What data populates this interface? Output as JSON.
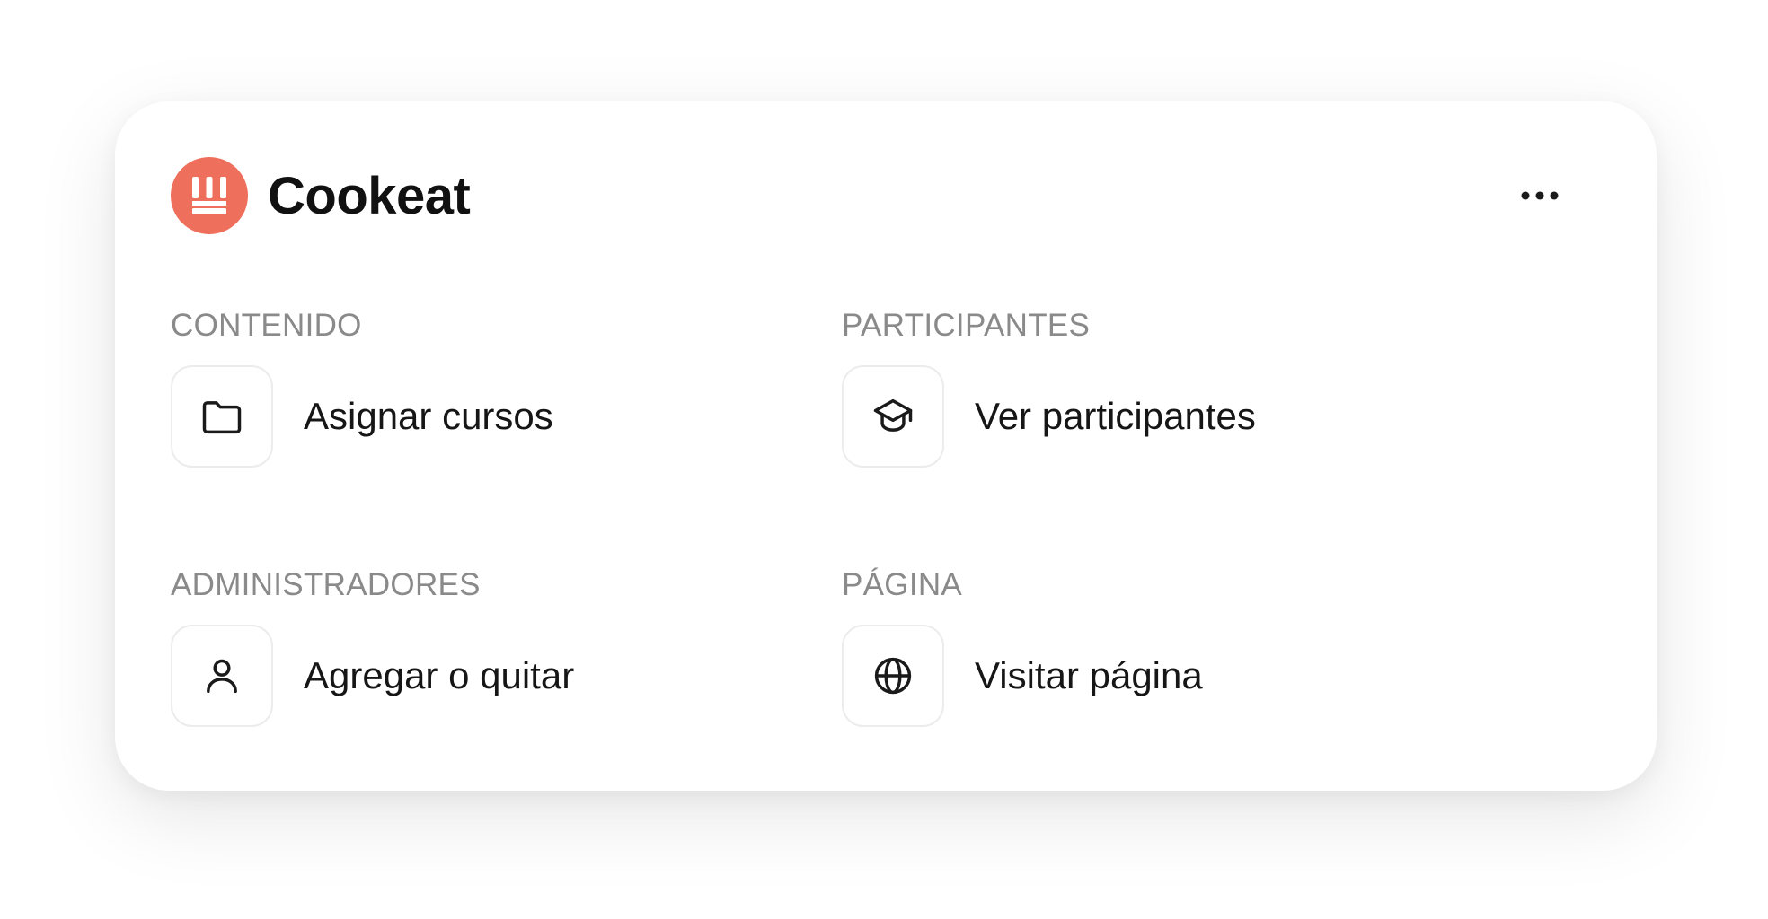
{
  "brand": {
    "name": "Cookeat",
    "logo_icon": "cookeat-logo-icon",
    "logo_color": "#ee6f5b"
  },
  "menu": {
    "icon": "more-horizontal-icon"
  },
  "sections": [
    {
      "title": "CONTENIDO",
      "action": {
        "label": "Asignar cursos",
        "icon": "folder-icon"
      }
    },
    {
      "title": "PARTICIPANTES",
      "action": {
        "label": "Ver participantes",
        "icon": "graduation-cap-icon"
      }
    },
    {
      "title": "ADMINISTRADORES",
      "action": {
        "label": "Agregar o quitar",
        "icon": "user-icon"
      }
    },
    {
      "title": "PÁGINA",
      "action": {
        "label": "Visitar página",
        "icon": "globe-icon"
      }
    }
  ]
}
